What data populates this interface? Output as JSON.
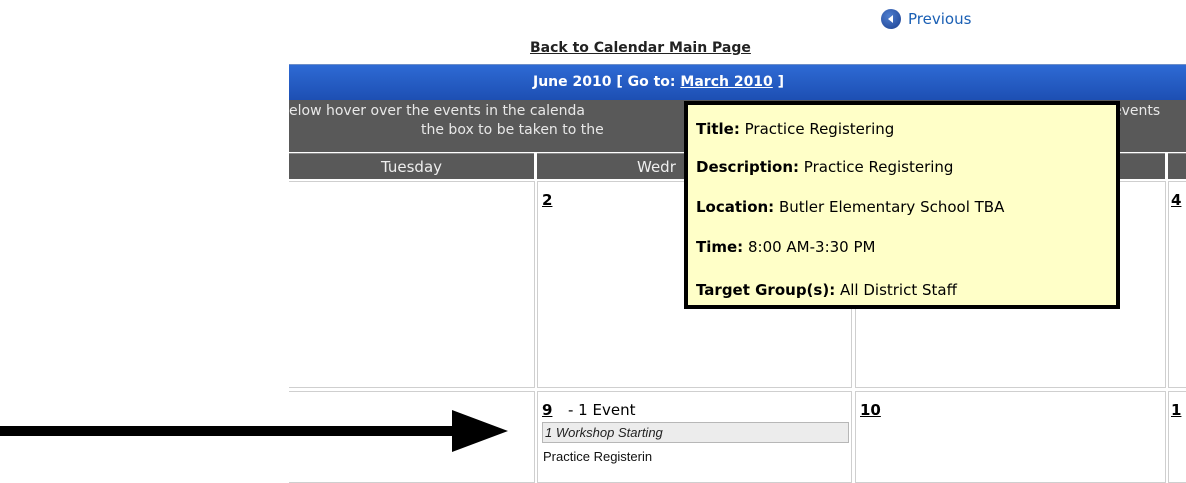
{
  "nav": {
    "previous_label": "Previous",
    "back_label": "Back to Calendar Main Page"
  },
  "header": {
    "month": "June 2010",
    "goto_prefix": "[ Go to:",
    "goto_month": "March 2010",
    "goto_suffix": "]"
  },
  "instructions": {
    "line1": "elow hover over the events in the calenda",
    "line2": "the box to be taken to the",
    "line1_right": "events"
  },
  "days": {
    "tuesday": "Tuesday",
    "wednesday": "Wedr",
    "thursday": "",
    "friday": ""
  },
  "week1": {
    "wed_num": "2",
    "fri_num": "4"
  },
  "week2": {
    "wed_num": "9",
    "wed_count": "- 1 Event",
    "wed_event_type": "1 Workshop Starting",
    "wed_event_title": "Practice Registerin",
    "thu_num": "10",
    "fri_num": "1"
  },
  "tooltip": {
    "title_label": "Title:",
    "title_value": "Practice Registering",
    "description_label": "Description:",
    "description_value": "Practice Registering",
    "location_label": "Location:",
    "location_value": "Butler Elementary School TBA",
    "time_label": "Time:",
    "time_value": "8:00 AM-3:30 PM",
    "target_label": "Target Group(s):",
    "target_value": "All District Staff"
  },
  "colors": {
    "header_blue": "#2e6ad4",
    "bar_gray": "#595959",
    "tooltip_bg": "#ffffc8"
  }
}
